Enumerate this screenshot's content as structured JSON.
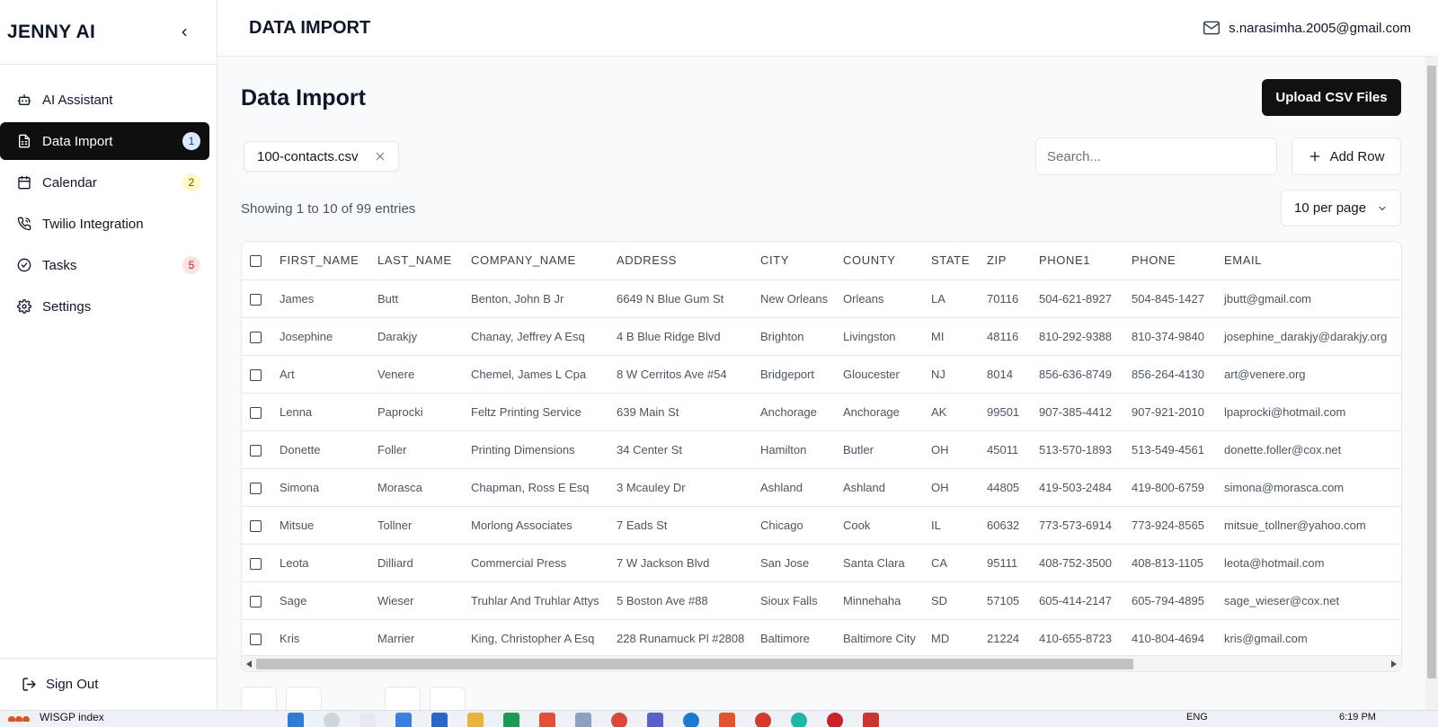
{
  "app": {
    "brand": "JENNY AI"
  },
  "sidebar": {
    "items": [
      {
        "label": "AI Assistant",
        "icon": "bot-icon",
        "badge": null,
        "active": false
      },
      {
        "label": "Data Import",
        "icon": "file-spreadsheet-icon",
        "badge": "1",
        "badge_color": "blue",
        "active": true
      },
      {
        "label": "Calendar",
        "icon": "calendar-icon",
        "badge": "2",
        "badge_color": "yellow",
        "active": false
      },
      {
        "label": "Twilio Integration",
        "icon": "phone-icon",
        "badge": null,
        "active": false
      },
      {
        "label": "Tasks",
        "icon": "check-circle-icon",
        "badge": "5",
        "badge_color": "red",
        "active": false
      },
      {
        "label": "Settings",
        "icon": "gear-icon",
        "badge": null,
        "active": false
      }
    ],
    "sign_out": "Sign Out"
  },
  "header": {
    "title": "DATA IMPORT",
    "user_email": "s.narasimha.2005@gmail.com"
  },
  "main": {
    "title": "Data Import",
    "upload_label": "Upload CSV Files",
    "file_chip": "100-contacts.csv",
    "search_placeholder": "Search...",
    "add_row_label": "Add Row",
    "entries_text": "Showing 1 to 10 of 99 entries",
    "per_page": "10 per page"
  },
  "table": {
    "columns": [
      "FIRST_NAME",
      "LAST_NAME",
      "COMPANY_NAME",
      "ADDRESS",
      "CITY",
      "COUNTY",
      "STATE",
      "ZIP",
      "PHONE1",
      "PHONE",
      "EMAIL"
    ],
    "rows": [
      [
        "James",
        "Butt",
        "Benton, John B Jr",
        "6649 N Blue Gum St",
        "New Orleans",
        "Orleans",
        "LA",
        "70116",
        "504-621-8927",
        "504-845-1427",
        "jbutt@gmail.com"
      ],
      [
        "Josephine",
        "Darakjy",
        "Chanay, Jeffrey A Esq",
        "4 B Blue Ridge Blvd",
        "Brighton",
        "Livingston",
        "MI",
        "48116",
        "810-292-9388",
        "810-374-9840",
        "josephine_darakjy@darakjy.org"
      ],
      [
        "Art",
        "Venere",
        "Chemel, James L Cpa",
        "8 W Cerritos Ave #54",
        "Bridgeport",
        "Gloucester",
        "NJ",
        "8014",
        "856-636-8749",
        "856-264-4130",
        "art@venere.org"
      ],
      [
        "Lenna",
        "Paprocki",
        "Feltz Printing Service",
        "639 Main St",
        "Anchorage",
        "Anchorage",
        "AK",
        "99501",
        "907-385-4412",
        "907-921-2010",
        "lpaprocki@hotmail.com"
      ],
      [
        "Donette",
        "Foller",
        "Printing Dimensions",
        "34 Center St",
        "Hamilton",
        "Butler",
        "OH",
        "45011",
        "513-570-1893",
        "513-549-4561",
        "donette.foller@cox.net"
      ],
      [
        "Simona",
        "Morasca",
        "Chapman, Ross E Esq",
        "3 Mcauley Dr",
        "Ashland",
        "Ashland",
        "OH",
        "44805",
        "419-503-2484",
        "419-800-6759",
        "simona@morasca.com"
      ],
      [
        "Mitsue",
        "Tollner",
        "Morlong Associates",
        "7 Eads St",
        "Chicago",
        "Cook",
        "IL",
        "60632",
        "773-573-6914",
        "773-924-8565",
        "mitsue_tollner@yahoo.com"
      ],
      [
        "Leota",
        "Dilliard",
        "Commercial Press",
        "7 W Jackson Blvd",
        "San Jose",
        "Santa Clara",
        "CA",
        "95111",
        "408-752-3500",
        "408-813-1105",
        "leota@hotmail.com"
      ],
      [
        "Sage",
        "Wieser",
        "Truhlar And Truhlar Attys",
        "5 Boston Ave #88",
        "Sioux Falls",
        "Minnehaha",
        "SD",
        "57105",
        "605-414-2147",
        "605-794-4895",
        "sage_wieser@cox.net"
      ],
      [
        "Kris",
        "Marrier",
        "King, Christopher A Esq",
        "228 Runamuck Pl #2808",
        "Baltimore",
        "Baltimore City",
        "MD",
        "21224",
        "410-655-8723",
        "410-804-4694",
        "kris@gmail.com"
      ]
    ]
  },
  "taskbar": {
    "window_title": "WISGP index",
    "language": "ENG",
    "time": "6:19 PM"
  },
  "colors": {
    "active_nav_bg": "#0f0f10",
    "primary_button": "#111111",
    "page_bg": "#f9fafb"
  }
}
